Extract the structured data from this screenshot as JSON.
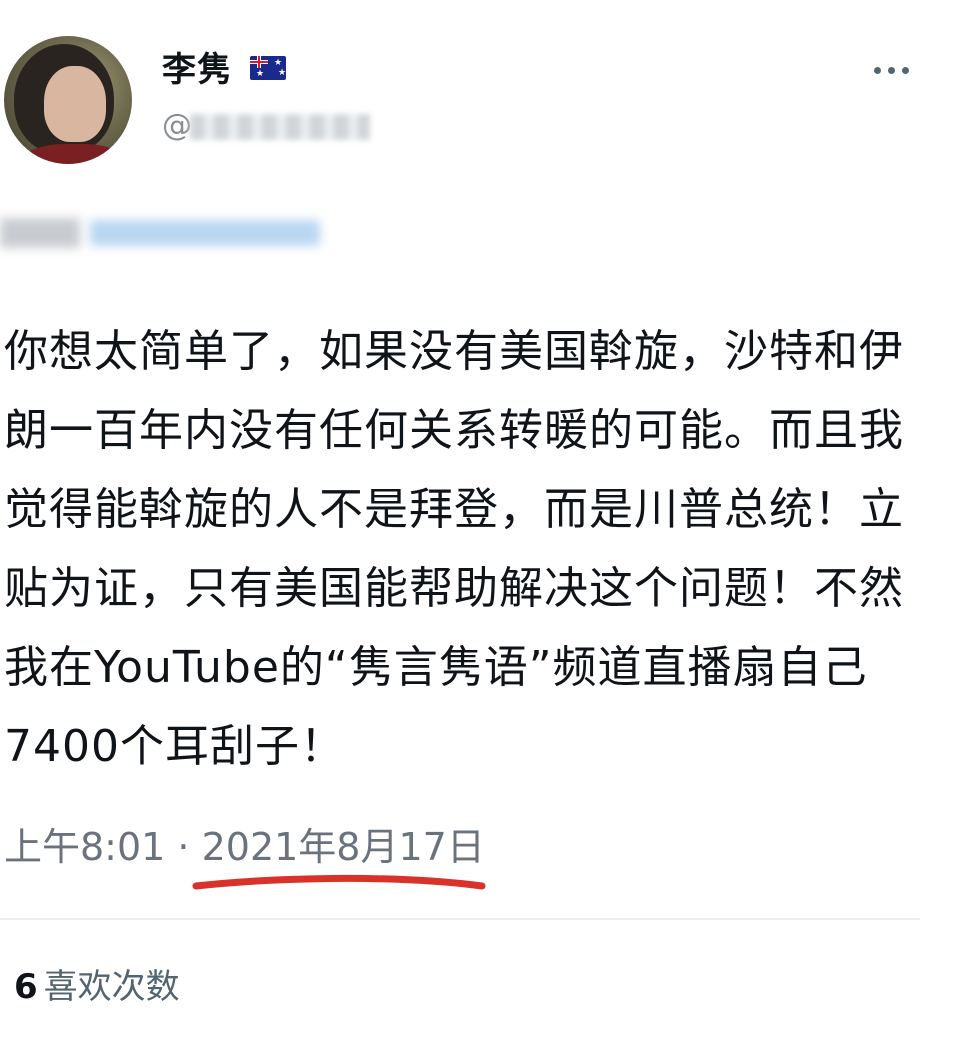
{
  "author": {
    "display_name": "李隽",
    "handle_prefix": "@",
    "flag": "australia-flag-icon"
  },
  "tweet": {
    "text": "你想太简单了，如果没有美国斡旋，沙特和伊\n朗一百年内没有任何关系转暖的可能。而且我\n觉得能斡旋的人不是拜登，而是川普总统！立\n贴为证，只有美国能帮助解决这个问题！不然\n我在YouTube的“隽言隽语”频道直播扇自己\n7400个耳刮子！",
    "time": "上午8:01",
    "separator": " · ",
    "date": "2021年8月17日"
  },
  "stats": {
    "likes_count": "6",
    "likes_label": "喜欢次数"
  },
  "colors": {
    "text": "#0f1419",
    "secondary": "#6a737d",
    "underline_annotation": "#d8322a",
    "divider": "#eceff1"
  }
}
